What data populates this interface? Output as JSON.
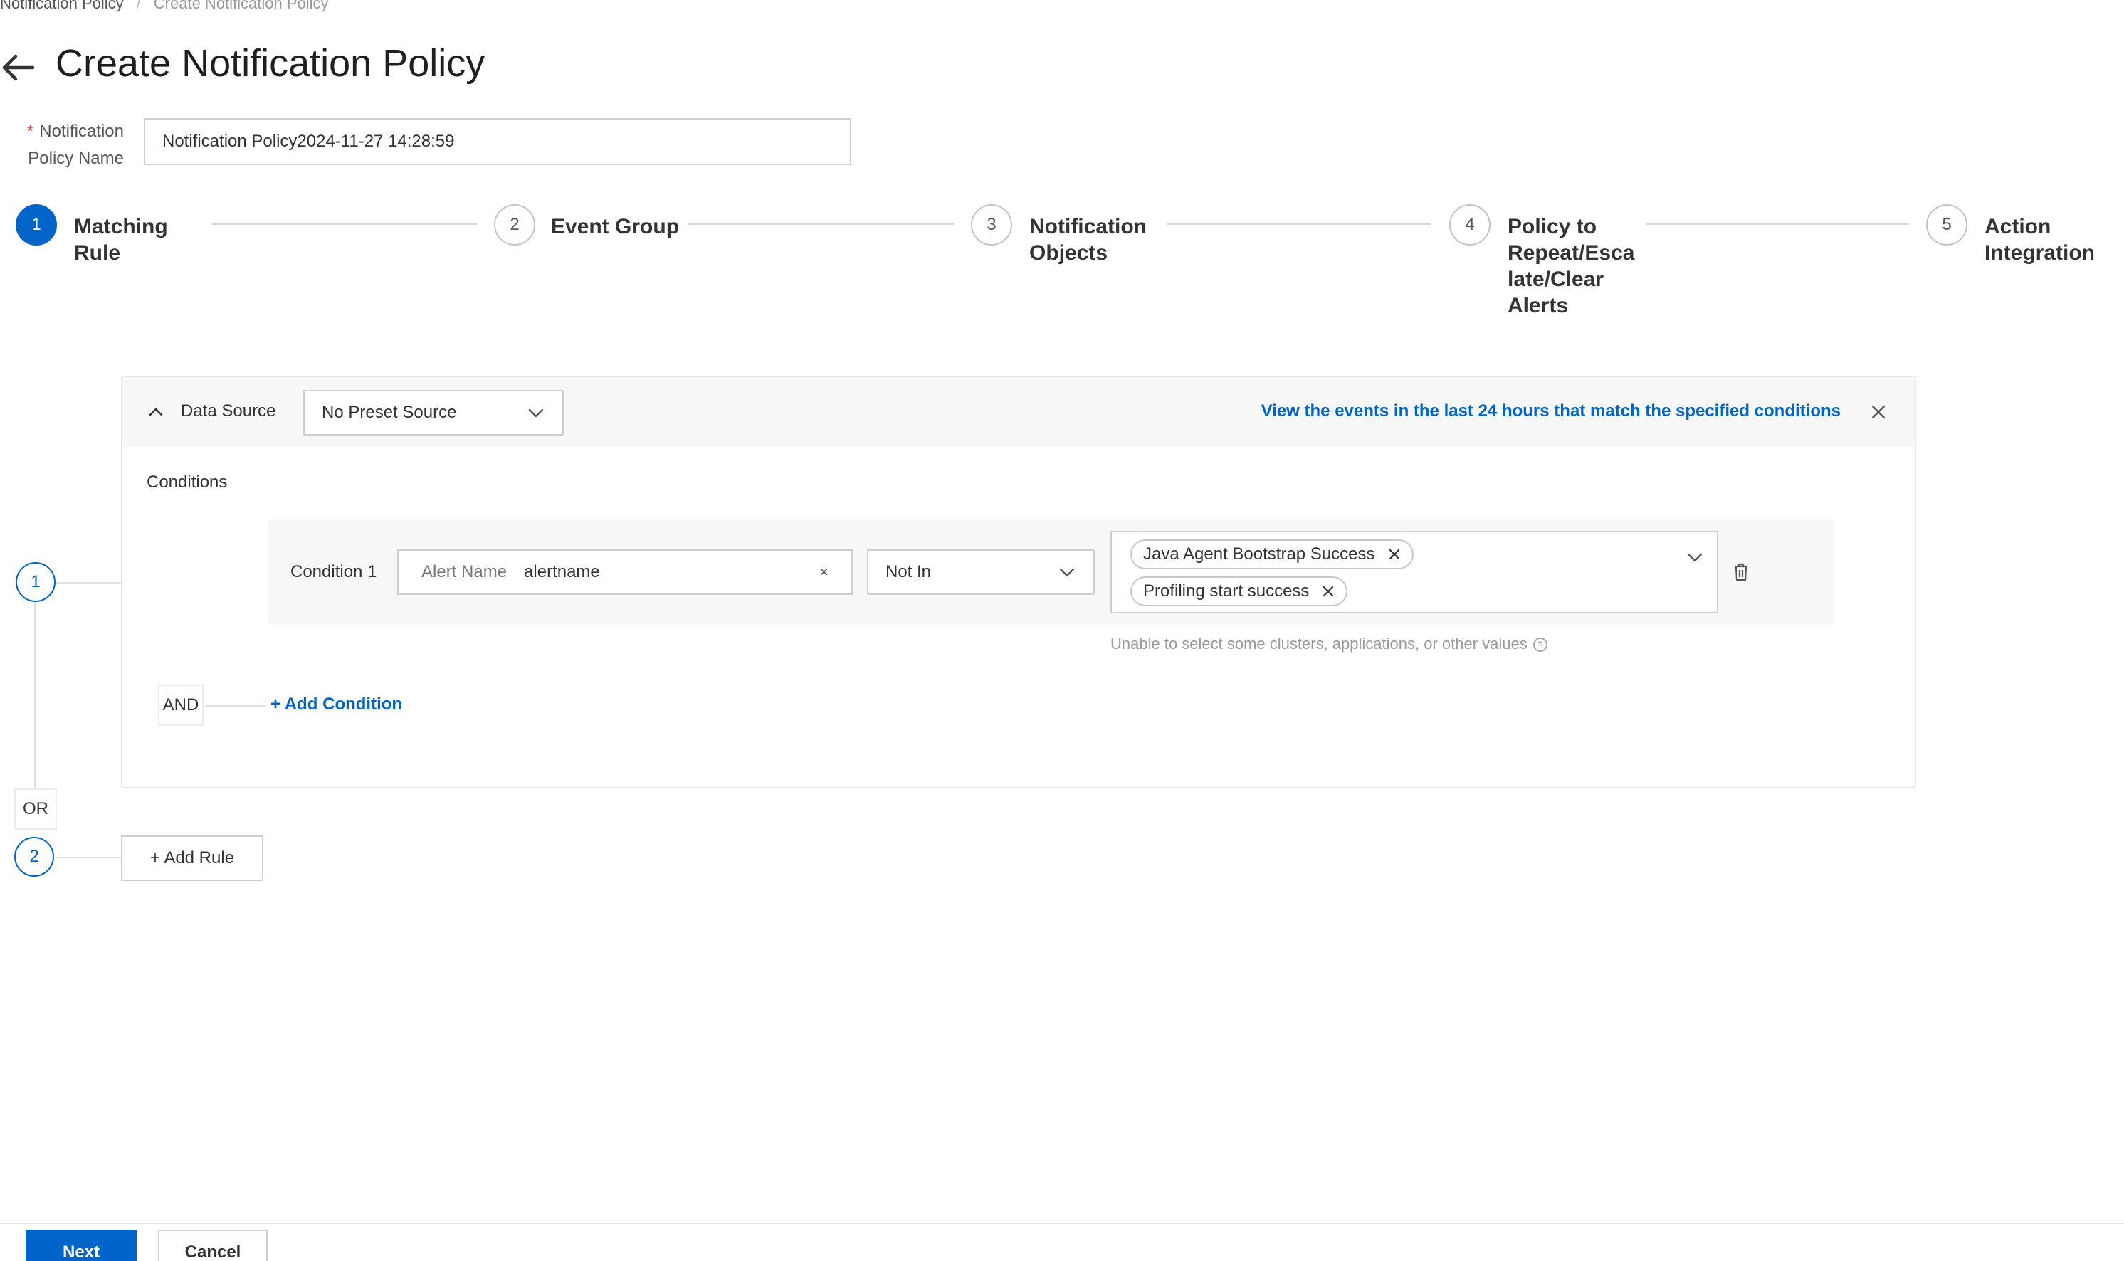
{
  "breadcrumb": {
    "parent": "Notification Policy",
    "current": "Create Notification Policy"
  },
  "header": {
    "title": "Create Notification Policy"
  },
  "policy_name": {
    "label_line1": "Notification",
    "label_line2": "Policy Name",
    "required_mark": "*",
    "value": "Notification Policy2024-11-27 14:28:59"
  },
  "steps": [
    {
      "number": "1",
      "label_lines": [
        "Matching",
        "Rule"
      ],
      "active": true
    },
    {
      "number": "2",
      "label_lines": [
        "Event Group"
      ],
      "active": false
    },
    {
      "number": "3",
      "label_lines": [
        "Notification",
        "Objects"
      ],
      "active": false
    },
    {
      "number": "4",
      "label_lines": [
        "Policy to",
        "Repeat/Esca",
        "late/Clear",
        "Alerts"
      ],
      "active": false
    },
    {
      "number": "5",
      "label_lines": [
        "Action",
        "Integration"
      ],
      "active": false
    }
  ],
  "rule": {
    "number": "1",
    "data_source_label": "Data Source",
    "data_source_value": "No Preset Source",
    "view_events_link": "View the events in the last 24 hours that match the specified conditions",
    "conditions_title": "Conditions",
    "condition": {
      "label": "Condition 1",
      "field_key": "Alert Name",
      "field_value": "alertname",
      "clear_glyph": "×",
      "operator": "Not In",
      "values": [
        "Java Agent Bootstrap Success",
        "Profiling start success"
      ]
    },
    "hint": "Unable to select some clusters, applications, or other values",
    "help_glyph": "?",
    "and_label": "AND",
    "add_condition": "+ Add Condition"
  },
  "or_label": "OR",
  "rule2_number": "2",
  "add_rule": "+ Add Rule",
  "footer": {
    "next": "Next",
    "cancel": "Cancel"
  },
  "colors": {
    "primary": "#0064c8",
    "required": "#e54545",
    "border": "#cfcfcf",
    "muted": "#999999"
  },
  "icons": {
    "back": "arrow-left-icon",
    "collapse": "chevron-up-icon",
    "dropdown": "chevron-down-icon",
    "close": "close-icon",
    "delete": "trash-icon",
    "help": "help-circle-icon"
  }
}
